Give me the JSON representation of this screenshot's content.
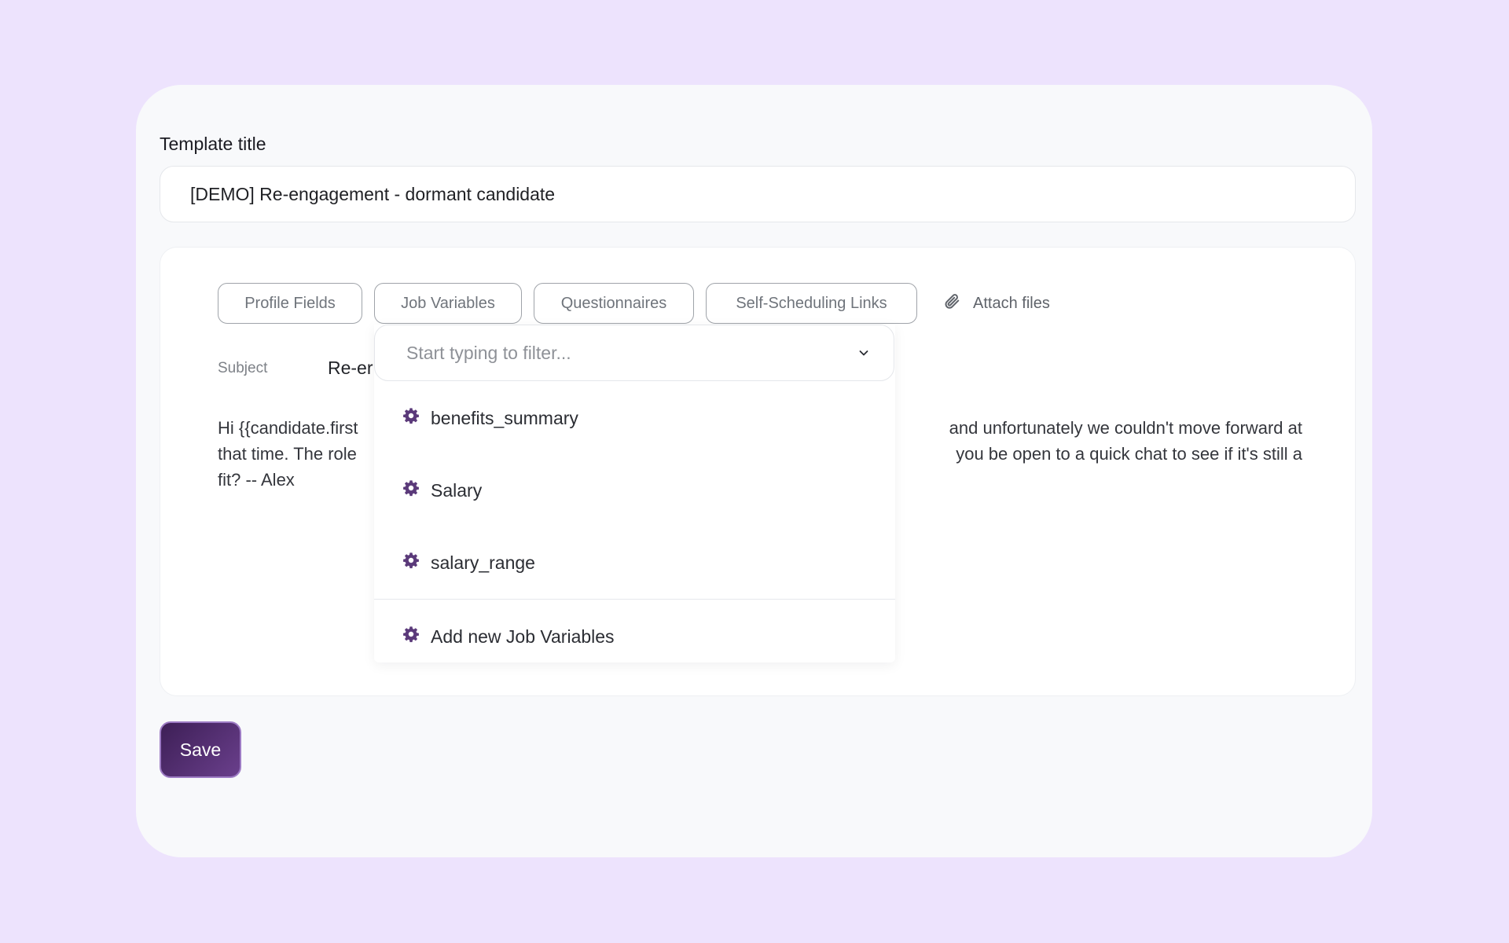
{
  "form": {
    "title_label": "Template title",
    "title_value": "[DEMO] Re-engagement - dormant candidate"
  },
  "toolbar": {
    "profile_fields": "Profile Fields",
    "job_variables": "Job Variables",
    "questionnaires": "Questionnaires",
    "self_scheduling": "Self-Scheduling Links",
    "attach_files": "Attach files"
  },
  "subject": {
    "label": "Subject",
    "value": "Re-er"
  },
  "body": {
    "left_line1": "Hi {{candidate.first",
    "left_line2": "that time. The role",
    "left_line3": "fit? -- Alex",
    "right_line1": "and unfortunately we couldn't move forward at",
    "right_line2": "you be open to a quick chat to see if it's still a"
  },
  "dropdown": {
    "filter_placeholder": "Start typing to filter...",
    "items": [
      {
        "label": "benefits_summary",
        "icon": "gear-icon"
      },
      {
        "label": "Salary",
        "icon": "gear-icon"
      },
      {
        "label": "salary_range",
        "icon": "gear-icon"
      }
    ],
    "add_new_label": "Add new Job Variables"
  },
  "actions": {
    "save_label": "Save"
  },
  "colors": {
    "background": "#ede3fd",
    "accent": "#5a3473",
    "icon": "#5b3a7a"
  }
}
